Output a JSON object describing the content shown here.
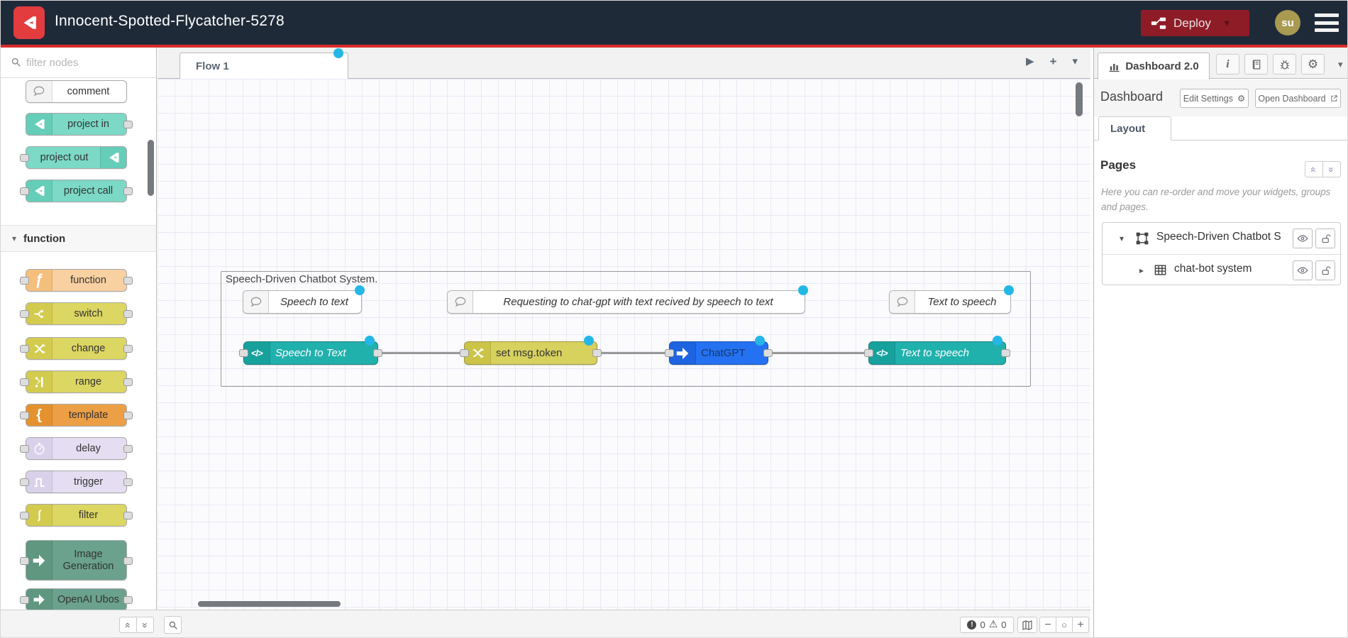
{
  "header": {
    "title": "Innocent-Spotted-Flycatcher-5278",
    "deploy_label": "Deploy",
    "avatar_text": "su"
  },
  "palette": {
    "filter_placeholder": "filter nodes",
    "section_function": "function",
    "items": [
      {
        "label": "comment",
        "color": "#ffffff",
        "icon_bg": "#f3f3f3"
      },
      {
        "label": "project in",
        "color": "#7bd9c6",
        "icon_bg": "#65cdb8"
      },
      {
        "label": "project out",
        "color": "#7bd9c6",
        "icon_bg": "#65cdb8"
      },
      {
        "label": "project call",
        "color": "#7bd9c6",
        "icon_bg": "#65cdb8"
      },
      {
        "label": "function",
        "color": "#f9d0a1",
        "icon_bg": "#f4bf7d"
      },
      {
        "label": "switch",
        "color": "#dcd662",
        "icon_bg": "#d2cb4e"
      },
      {
        "label": "change",
        "color": "#dcd662",
        "icon_bg": "#d2cb4e"
      },
      {
        "label": "range",
        "color": "#dcd662",
        "icon_bg": "#d2cb4e"
      },
      {
        "label": "template",
        "color": "#ec9f45",
        "icon_bg": "#e4922e"
      },
      {
        "label": "delay",
        "color": "#e5def2",
        "icon_bg": "#d9d1ea"
      },
      {
        "label": "trigger",
        "color": "#e5def2",
        "icon_bg": "#d9d1ea"
      },
      {
        "label": "filter",
        "color": "#dcd662",
        "icon_bg": "#d2cb4e"
      },
      {
        "label": "Image Generation",
        "color": "#6ba28d",
        "icon_bg": "#5f9781"
      },
      {
        "label": "OpenAI Ubos",
        "color": "#6ba28d",
        "icon_bg": "#5f9781"
      }
    ]
  },
  "canvas": {
    "tab_label": "Flow 1",
    "group_label": "Speech-Driven Chatbot System.",
    "changed_dot_color": "#24b7e5",
    "comments": [
      {
        "label": "Speech to text"
      },
      {
        "label": "Requesting to chat-gpt with text recived by speech to text"
      },
      {
        "label": "Text to speech"
      }
    ],
    "nodes": [
      {
        "label": "Speech to Text",
        "color": "#21b1ad",
        "icon_bg": "#17a19d",
        "text_color": "#ffffff"
      },
      {
        "label": "set msg.token",
        "color": "#d7d15e",
        "icon_bg": "#cbc449",
        "text_color": "#333333"
      },
      {
        "label": "ChatGPT",
        "color": "#2472f2",
        "icon_bg": "#1e63df",
        "text_color": "#15386b"
      },
      {
        "label": "Text to speech",
        "color": "#21b1ad",
        "icon_bg": "#17a19d",
        "text_color": "#ffffff"
      }
    ],
    "footer": {
      "error_count": "0",
      "warning_count": "0"
    }
  },
  "sidebar": {
    "tab_label": "Dashboard 2.0",
    "section_title": "Dashboard",
    "edit_settings_label": "Edit Settings",
    "open_dashboard_label": "Open Dashboard",
    "layout_tab_label": "Layout",
    "pages_title": "Pages",
    "hint": "Here you can re-order and move your widgets, groups and pages.",
    "rows": [
      {
        "label": "Speech-Driven Chatbot S"
      },
      {
        "label": "chat-bot system"
      }
    ]
  }
}
